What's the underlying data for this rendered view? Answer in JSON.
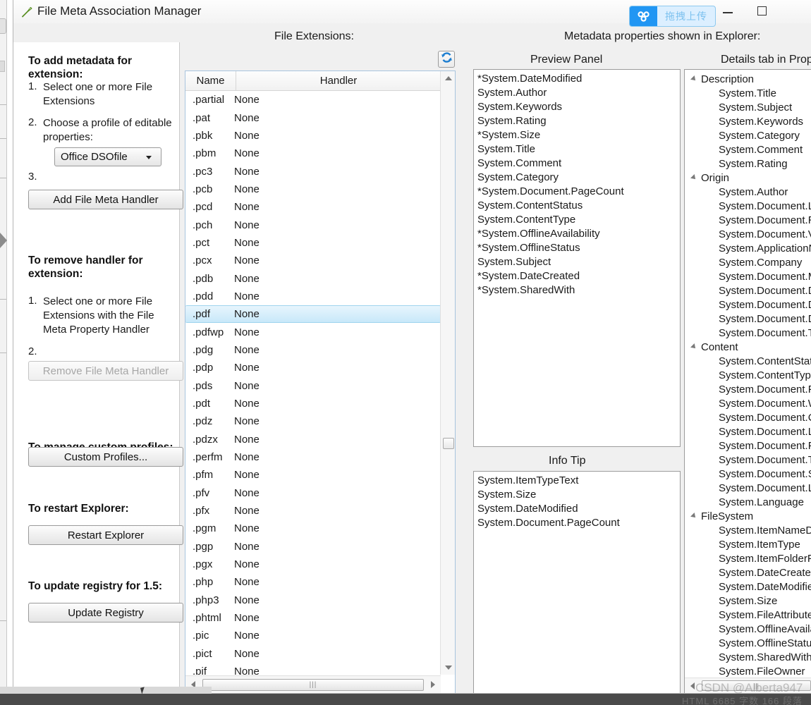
{
  "window": {
    "title": "File Meta Association Manager",
    "title_icon": "green-tag-icon",
    "minimize_label": "Minimize",
    "maximize_label": "Maximize"
  },
  "upload_widget": {
    "icon": "baidu-cloud-icon",
    "label": "拖拽上传",
    "icon_color": "#2196f3",
    "label_color": "#7cc1ef",
    "bg_color": "#dcefff"
  },
  "captions": {
    "file_extensions": "File Extensions:",
    "metadata_properties": "Metadata properties shown in Explorer:",
    "preview_panel": "Preview Panel",
    "details_tab": "Details tab in Properties",
    "info_tip": "Info Tip"
  },
  "left_panel": {
    "add_heading": "To add metadata for extension:",
    "add_step1_num": "1.",
    "add_step1_text": "Select one or more File Extensions",
    "add_step2_num": "2.",
    "add_step2_text": "Choose a profile of editable properties:",
    "profile_value": "Office DSOfile",
    "add_step3_num": "3.",
    "add_button": "Add File Meta Handler",
    "remove_heading": "To remove handler for extension:",
    "remove_step1_num": "1.",
    "remove_step1_text": "Select one or more File Extensions with the File Meta Property Handler",
    "remove_step2_num": "2.",
    "remove_button": "Remove File Meta Handler",
    "remove_button_disabled": true,
    "profiles_heading": "To manage custom profiles:",
    "profiles_button": "Custom Profiles...",
    "restart_heading": "To restart Explorer:",
    "restart_button": "Restart Explorer",
    "registry_heading": "To update registry for 1.5:",
    "registry_button": "Update Registry"
  },
  "extension_list": {
    "refresh_icon": "refresh-icon",
    "columns": [
      "Name",
      "Handler"
    ],
    "selected": ".pdf",
    "rows": [
      {
        "name": ".partial",
        "handler": "None"
      },
      {
        "name": ".pat",
        "handler": "None"
      },
      {
        "name": ".pbk",
        "handler": "None"
      },
      {
        "name": ".pbm",
        "handler": "None"
      },
      {
        "name": ".pc3",
        "handler": "None"
      },
      {
        "name": ".pcb",
        "handler": "None"
      },
      {
        "name": ".pcd",
        "handler": "None"
      },
      {
        "name": ".pch",
        "handler": "None"
      },
      {
        "name": ".pct",
        "handler": "None"
      },
      {
        "name": ".pcx",
        "handler": "None"
      },
      {
        "name": ".pdb",
        "handler": "None"
      },
      {
        "name": ".pdd",
        "handler": "None"
      },
      {
        "name": ".pdf",
        "handler": "None"
      },
      {
        "name": ".pdfwp",
        "handler": "None"
      },
      {
        "name": ".pdg",
        "handler": "None"
      },
      {
        "name": ".pdp",
        "handler": "None"
      },
      {
        "name": ".pds",
        "handler": "None"
      },
      {
        "name": ".pdt",
        "handler": "None"
      },
      {
        "name": ".pdz",
        "handler": "None"
      },
      {
        "name": ".pdzx",
        "handler": "None"
      },
      {
        "name": ".perfm",
        "handler": "None"
      },
      {
        "name": ".pfm",
        "handler": "None"
      },
      {
        "name": ".pfv",
        "handler": "None"
      },
      {
        "name": ".pfx",
        "handler": "None"
      },
      {
        "name": ".pgm",
        "handler": "None"
      },
      {
        "name": ".pgp",
        "handler": "None"
      },
      {
        "name": ".pgx",
        "handler": "None"
      },
      {
        "name": ".php",
        "handler": "None"
      },
      {
        "name": ".php3",
        "handler": "None"
      },
      {
        "name": ".phtml",
        "handler": "None"
      },
      {
        "name": ".pic",
        "handler": "None"
      },
      {
        "name": ".pict",
        "handler": "None"
      },
      {
        "name": ".pif",
        "handler": "None"
      }
    ]
  },
  "preview_panel": {
    "items": [
      "*System.DateModified",
      "System.Author",
      "System.Keywords",
      "System.Rating",
      "*System.Size",
      "System.Title",
      "System.Comment",
      "System.Category",
      "*System.Document.PageCount",
      "System.ContentStatus",
      "System.ContentType",
      "*System.OfflineAvailability",
      "*System.OfflineStatus",
      "System.Subject",
      "*System.DateCreated",
      "*System.SharedWith"
    ]
  },
  "info_tip": {
    "items": [
      "System.ItemTypeText",
      "System.Size",
      "System.DateModified",
      "System.Document.PageCount"
    ]
  },
  "details_tree": {
    "groups": [
      {
        "label": "Description",
        "items": [
          "System.Title",
          "System.Subject",
          "System.Keywords",
          "System.Category",
          "System.Comment",
          "System.Rating"
        ]
      },
      {
        "label": "Origin",
        "items": [
          "System.Author",
          "System.Document.LastAuthor",
          "System.Document.RevisionNumber",
          "System.Document.Version",
          "System.ApplicationName",
          "System.Company",
          "System.Document.Manager",
          "System.Document.DateCreated",
          "System.Document.DateSaved",
          "System.Document.DatePrinted",
          "System.Document.TotalEditingTime"
        ]
      },
      {
        "label": "Content",
        "items": [
          "System.ContentStatus",
          "System.ContentType",
          "System.Document.PageCount",
          "System.Document.WordCount",
          "System.Document.CharacterCount",
          "System.Document.LineCount",
          "System.Document.ParagraphCount",
          "System.Document.Template",
          "System.Document.Scale",
          "System.Document.LinksDirty",
          "System.Language"
        ]
      },
      {
        "label": "FileSystem",
        "items": [
          "System.ItemNameDisplay",
          "System.ItemType",
          "System.ItemFolderPathDisplay",
          "System.DateCreated",
          "System.DateModified",
          "System.Size",
          "System.FileAttributes",
          "System.OfflineAvailability",
          "System.OfflineStatus",
          "System.SharedWith",
          "System.FileOwner"
        ]
      }
    ]
  },
  "watermark": "CSDN @Alberta947",
  "taskbar": {
    "text": "HTML  6685 字数  166 段落"
  }
}
